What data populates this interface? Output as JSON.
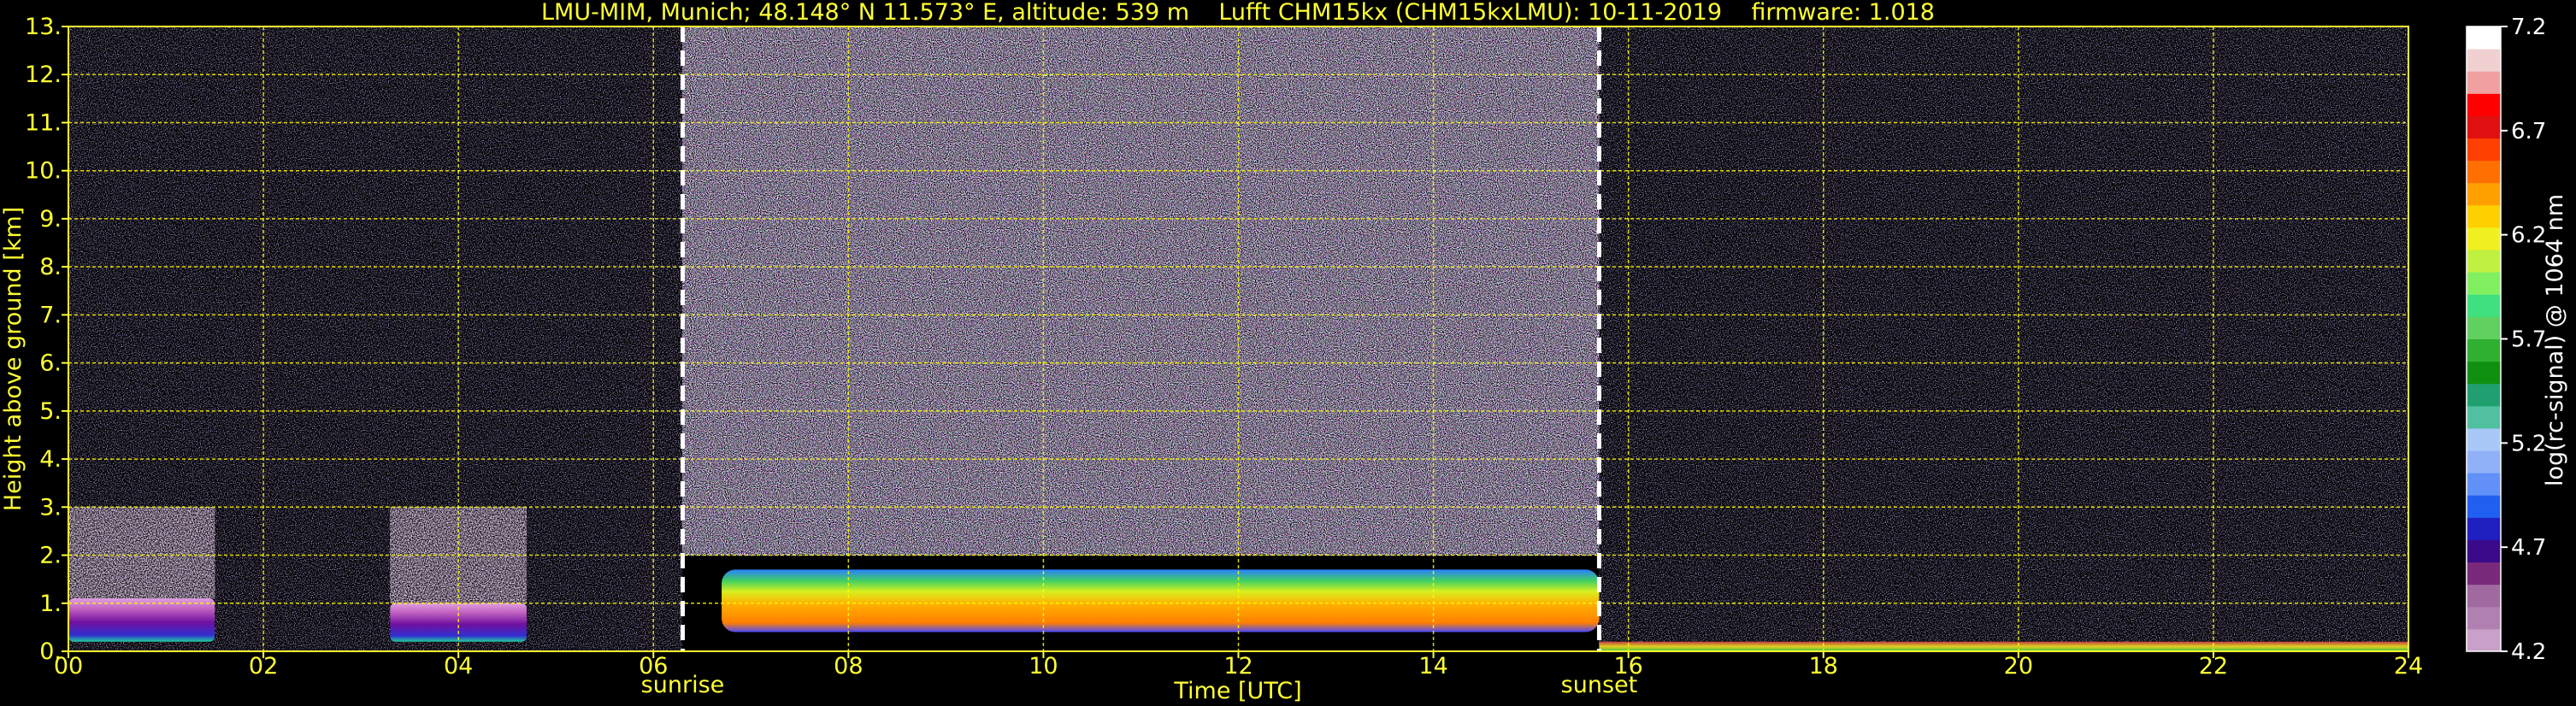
{
  "chart_data": {
    "type": "heatmap",
    "title": "LMU-MIM, Munich; 48.148° N 11.573° E, altitude: 539 m    Lufft CHM15kx (CHM15kxLMU): 10-11-2019    firmware: 1.018",
    "xlabel": "Time [UTC]",
    "ylabel": "Height above ground [km]",
    "xlim": [
      0,
      24
    ],
    "ylim": [
      0,
      13
    ],
    "x_ticks": [
      0,
      2,
      4,
      6,
      8,
      10,
      12,
      14,
      16,
      18,
      20,
      22,
      24
    ],
    "x_tick_labels": [
      "00",
      "02",
      "04",
      "06",
      "08",
      "10",
      "12",
      "14",
      "16",
      "18",
      "20",
      "22",
      "24"
    ],
    "y_ticks": [
      0,
      1,
      2,
      3,
      4,
      5,
      6,
      7,
      8,
      9,
      10,
      11,
      12,
      13
    ],
    "y_tick_labels": [
      "0.",
      "1.",
      "2.",
      "3.",
      "4.",
      "5.",
      "6.",
      "7.",
      "8.",
      "9.",
      "10.",
      "11.",
      "12.",
      "13."
    ],
    "grid": true,
    "grid_color": "#ffff00",
    "background": "#000000",
    "text_color": "#ffff33",
    "annotations": [
      {
        "label": "sunrise",
        "time": 6.3
      },
      {
        "label": "sunset",
        "time": 15.7
      }
    ],
    "colorbar": {
      "label": "log(rc-signal) @ 1064 nm",
      "range": [
        4.2,
        7.2
      ],
      "tick_values": [
        4.2,
        4.7,
        5.2,
        5.7,
        6.2,
        6.7,
        7.2
      ],
      "tick_labels": [
        "4.2",
        "4.7",
        "5.2",
        "5.7",
        "6.2",
        "6.7",
        "7.2"
      ],
      "colors": [
        "#c8a0c8",
        "#b080b0",
        "#a06aa0",
        "#7a2a7a",
        "#3a0a8a",
        "#2020c0",
        "#2060f0",
        "#6090f8",
        "#90b0f8",
        "#a8c8f8",
        "#50c0a0",
        "#20a070",
        "#109010",
        "#30b030",
        "#60d060",
        "#40e080",
        "#80f060",
        "#c0f040",
        "#f0f020",
        "#ffd000",
        "#ffa000",
        "#ff7000",
        "#ff4000",
        "#e01010",
        "#ff0000",
        "#f0a0a0",
        "#f0d0d0",
        "#ffffff"
      ]
    },
    "features": [
      {
        "name": "night noise",
        "time": [
          0,
          6.3
        ],
        "height": [
          0,
          13
        ],
        "level": 4.6
      },
      {
        "name": "daytime noise",
        "time": [
          6.3,
          15.7
        ],
        "height": [
          2.0,
          13
        ],
        "level": 5.6
      },
      {
        "name": "evening noise",
        "time": [
          15.7,
          24
        ],
        "height": [
          0,
          13
        ],
        "level": 4.5
      },
      {
        "name": "low cloud",
        "time": [
          0,
          1.5
        ],
        "height": [
          0.2,
          1.1
        ],
        "level": 4.9
      },
      {
        "name": "low cloud",
        "time": [
          3.3,
          4.7
        ],
        "height": [
          0.2,
          1.0
        ],
        "level": 4.9
      },
      {
        "name": "aerosol layer",
        "time": [
          6.7,
          15.7
        ],
        "height": [
          0.4,
          1.7
        ],
        "level": 6.1
      },
      {
        "name": "surface layer",
        "time": [
          15.7,
          24
        ],
        "height": [
          0,
          0.2
        ],
        "level": 5.8
      }
    ]
  }
}
